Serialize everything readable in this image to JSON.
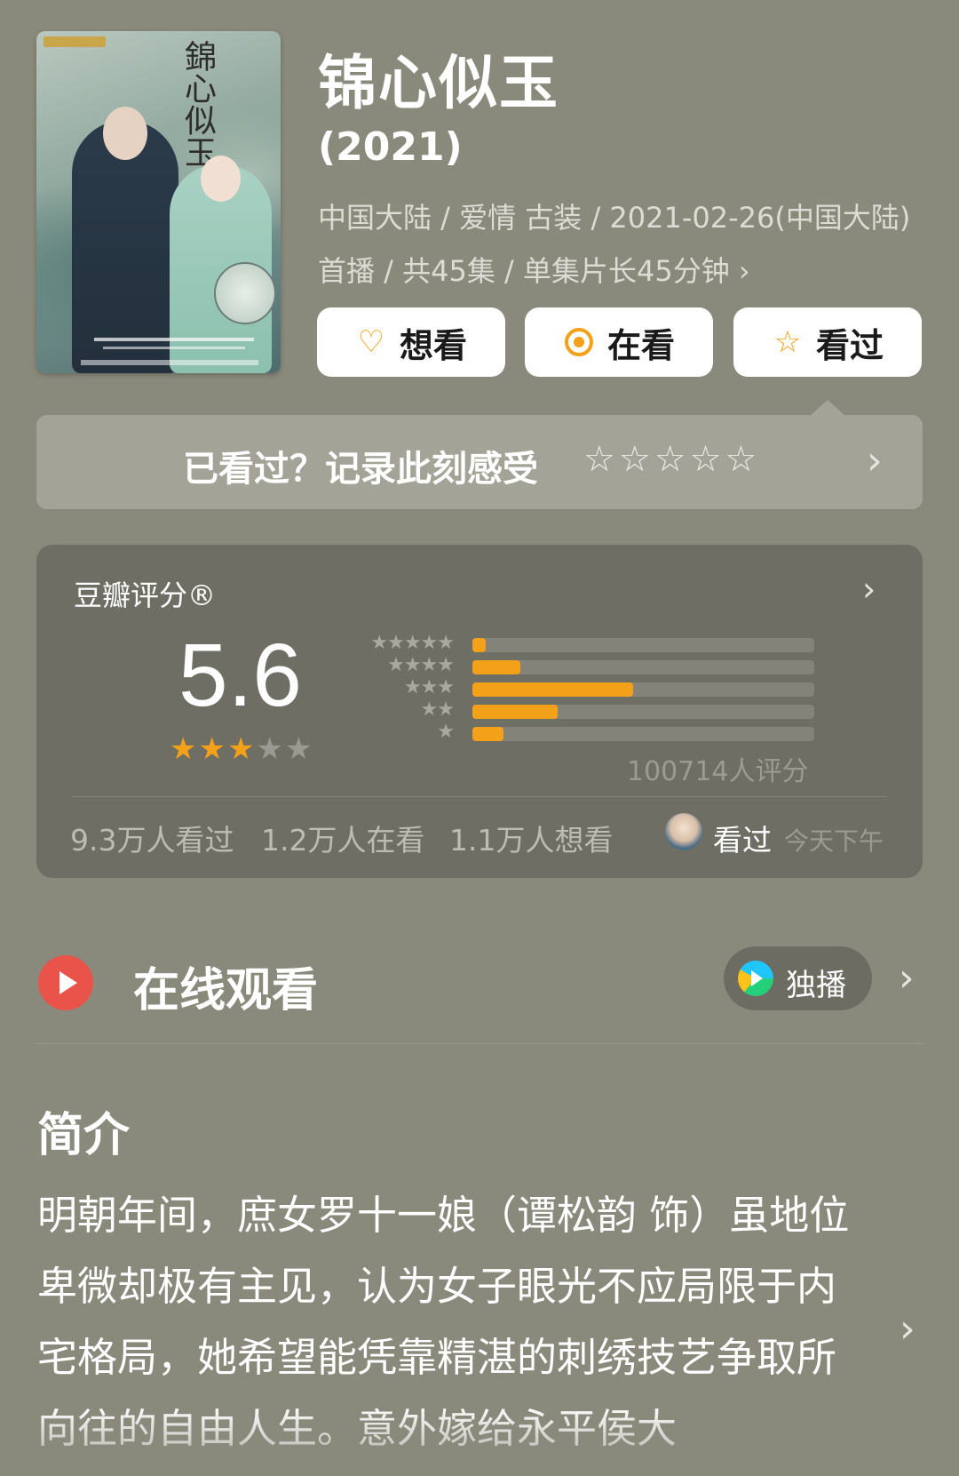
{
  "movie": {
    "title": "锦心似玉",
    "year": "(2021)",
    "meta": "中国大陆 / 爱情 古装 / 2021-02-26(中国大陆)首播 / 共45集 / 单集片长45分钟 ›"
  },
  "actions": {
    "want": "想看",
    "watching": "在看",
    "watched": "看过"
  },
  "record": {
    "prompt": "已看过？记录此刻感受",
    "stars": "☆☆☆☆☆"
  },
  "rating": {
    "label": "豆瓣评分®",
    "score": "5.6",
    "score_stars": 3,
    "histogram": [
      {
        "stars": "★★★★★",
        "percent": 4
      },
      {
        "stars": "★★★★",
        "percent": 14
      },
      {
        "stars": "★★★",
        "percent": 47
      },
      {
        "stars": "★★",
        "percent": 25
      },
      {
        "stars": "★",
        "percent": 9
      }
    ],
    "count": "100714人评分",
    "stats": {
      "watched": "9.3万人看过",
      "watching": "1.2万人在看",
      "want": "1.1万人想看"
    },
    "friend_action": "看过",
    "friend_time": "今天下午"
  },
  "online": {
    "heading": "在线观看",
    "badge": "独播"
  },
  "intro": {
    "heading": "简介",
    "text": "明朝年间，庶女罗十一娘（谭松韵 饰）虽地位卑微却极有主见，认为女子眼光不应局限于内宅格局，她希望能凭靠精湛的刺绣技艺争取所向往的自由人生。意外嫁给永平侯大"
  },
  "colors": {
    "background": "#8a8a7c",
    "accent": "#f4a11a",
    "play_red": "#e9534a"
  },
  "icons": {
    "want": "heart-plus-icon",
    "watching": "target-icon",
    "watched": "star-outline-icon",
    "online": "play-circle-icon",
    "platform": "tencent-video-icon"
  }
}
